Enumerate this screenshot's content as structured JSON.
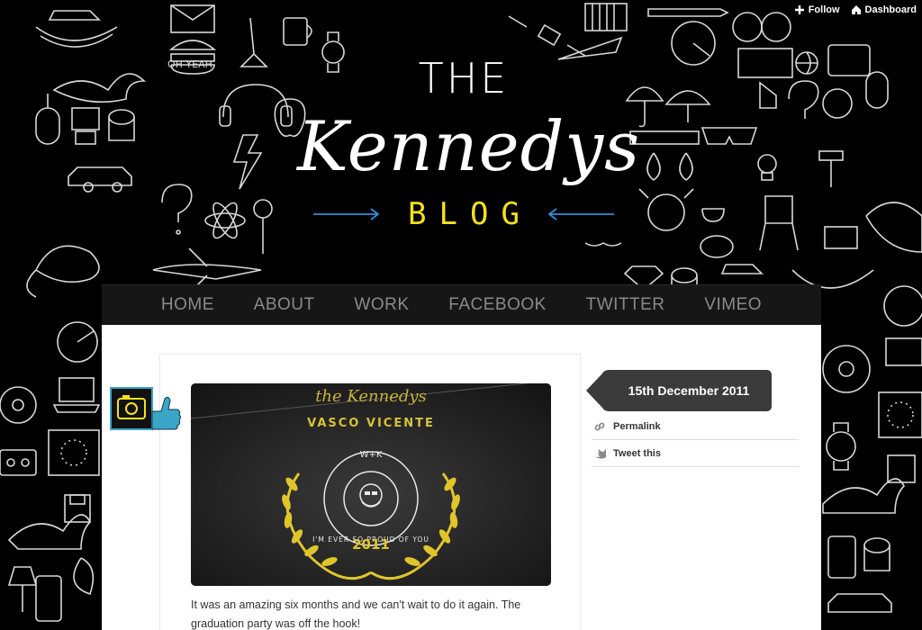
{
  "controls": {
    "follow_label": "Follow",
    "dashboard_label": "Dashboard"
  },
  "header": {
    "title_top": "THE",
    "title_main": "Kennedys",
    "title_sub": "BLOG"
  },
  "nav": [
    {
      "label": "HOME"
    },
    {
      "label": "ABOUT"
    },
    {
      "label": "WORK"
    },
    {
      "label": "FACEBOOK"
    },
    {
      "label": "TWITTER"
    },
    {
      "label": "VIMEO"
    }
  ],
  "post": {
    "text": "It was an amazing six months and we can't wait to do it again. The graduation party was off the hook!",
    "date": "15th December 2011",
    "image": {
      "top_script": "the Kennedys",
      "name": "VASCO VICENTE",
      "badge_top": "W+K",
      "ring_text": "I'M EVER SO PROUD OF YOU",
      "year": "2011"
    },
    "links": [
      {
        "label": "Permalink",
        "icon": "link-icon"
      },
      {
        "label": "Tweet this",
        "icon": "twitter-bird-icon"
      }
    ]
  },
  "colors": {
    "accent_yellow": "#f5e21b",
    "accent_blue": "#2e8fd8",
    "badge_teal": "#3aa6c8"
  }
}
